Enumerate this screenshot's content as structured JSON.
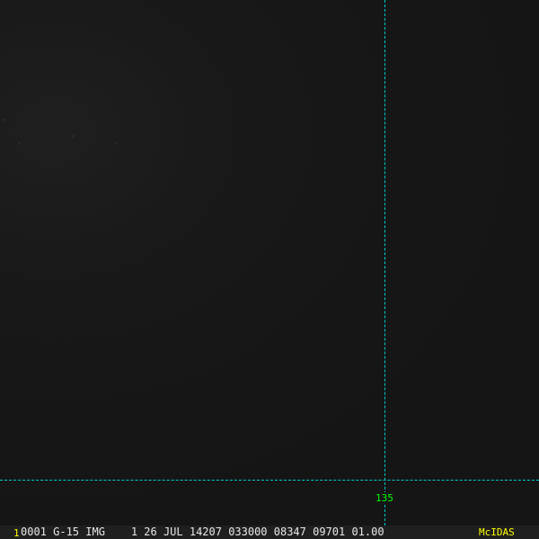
{
  "overlay": {
    "longitude_label": "135"
  },
  "status_bar": {
    "frame_number": "1",
    "info": "0001 G-15 IMG    1 26 JUL 14207 033000 08347 09701 01.00",
    "brand": "McIDAS"
  },
  "colors": {
    "grid": "#00cccc",
    "label": "#00ff00",
    "brand": "#ffff00"
  }
}
